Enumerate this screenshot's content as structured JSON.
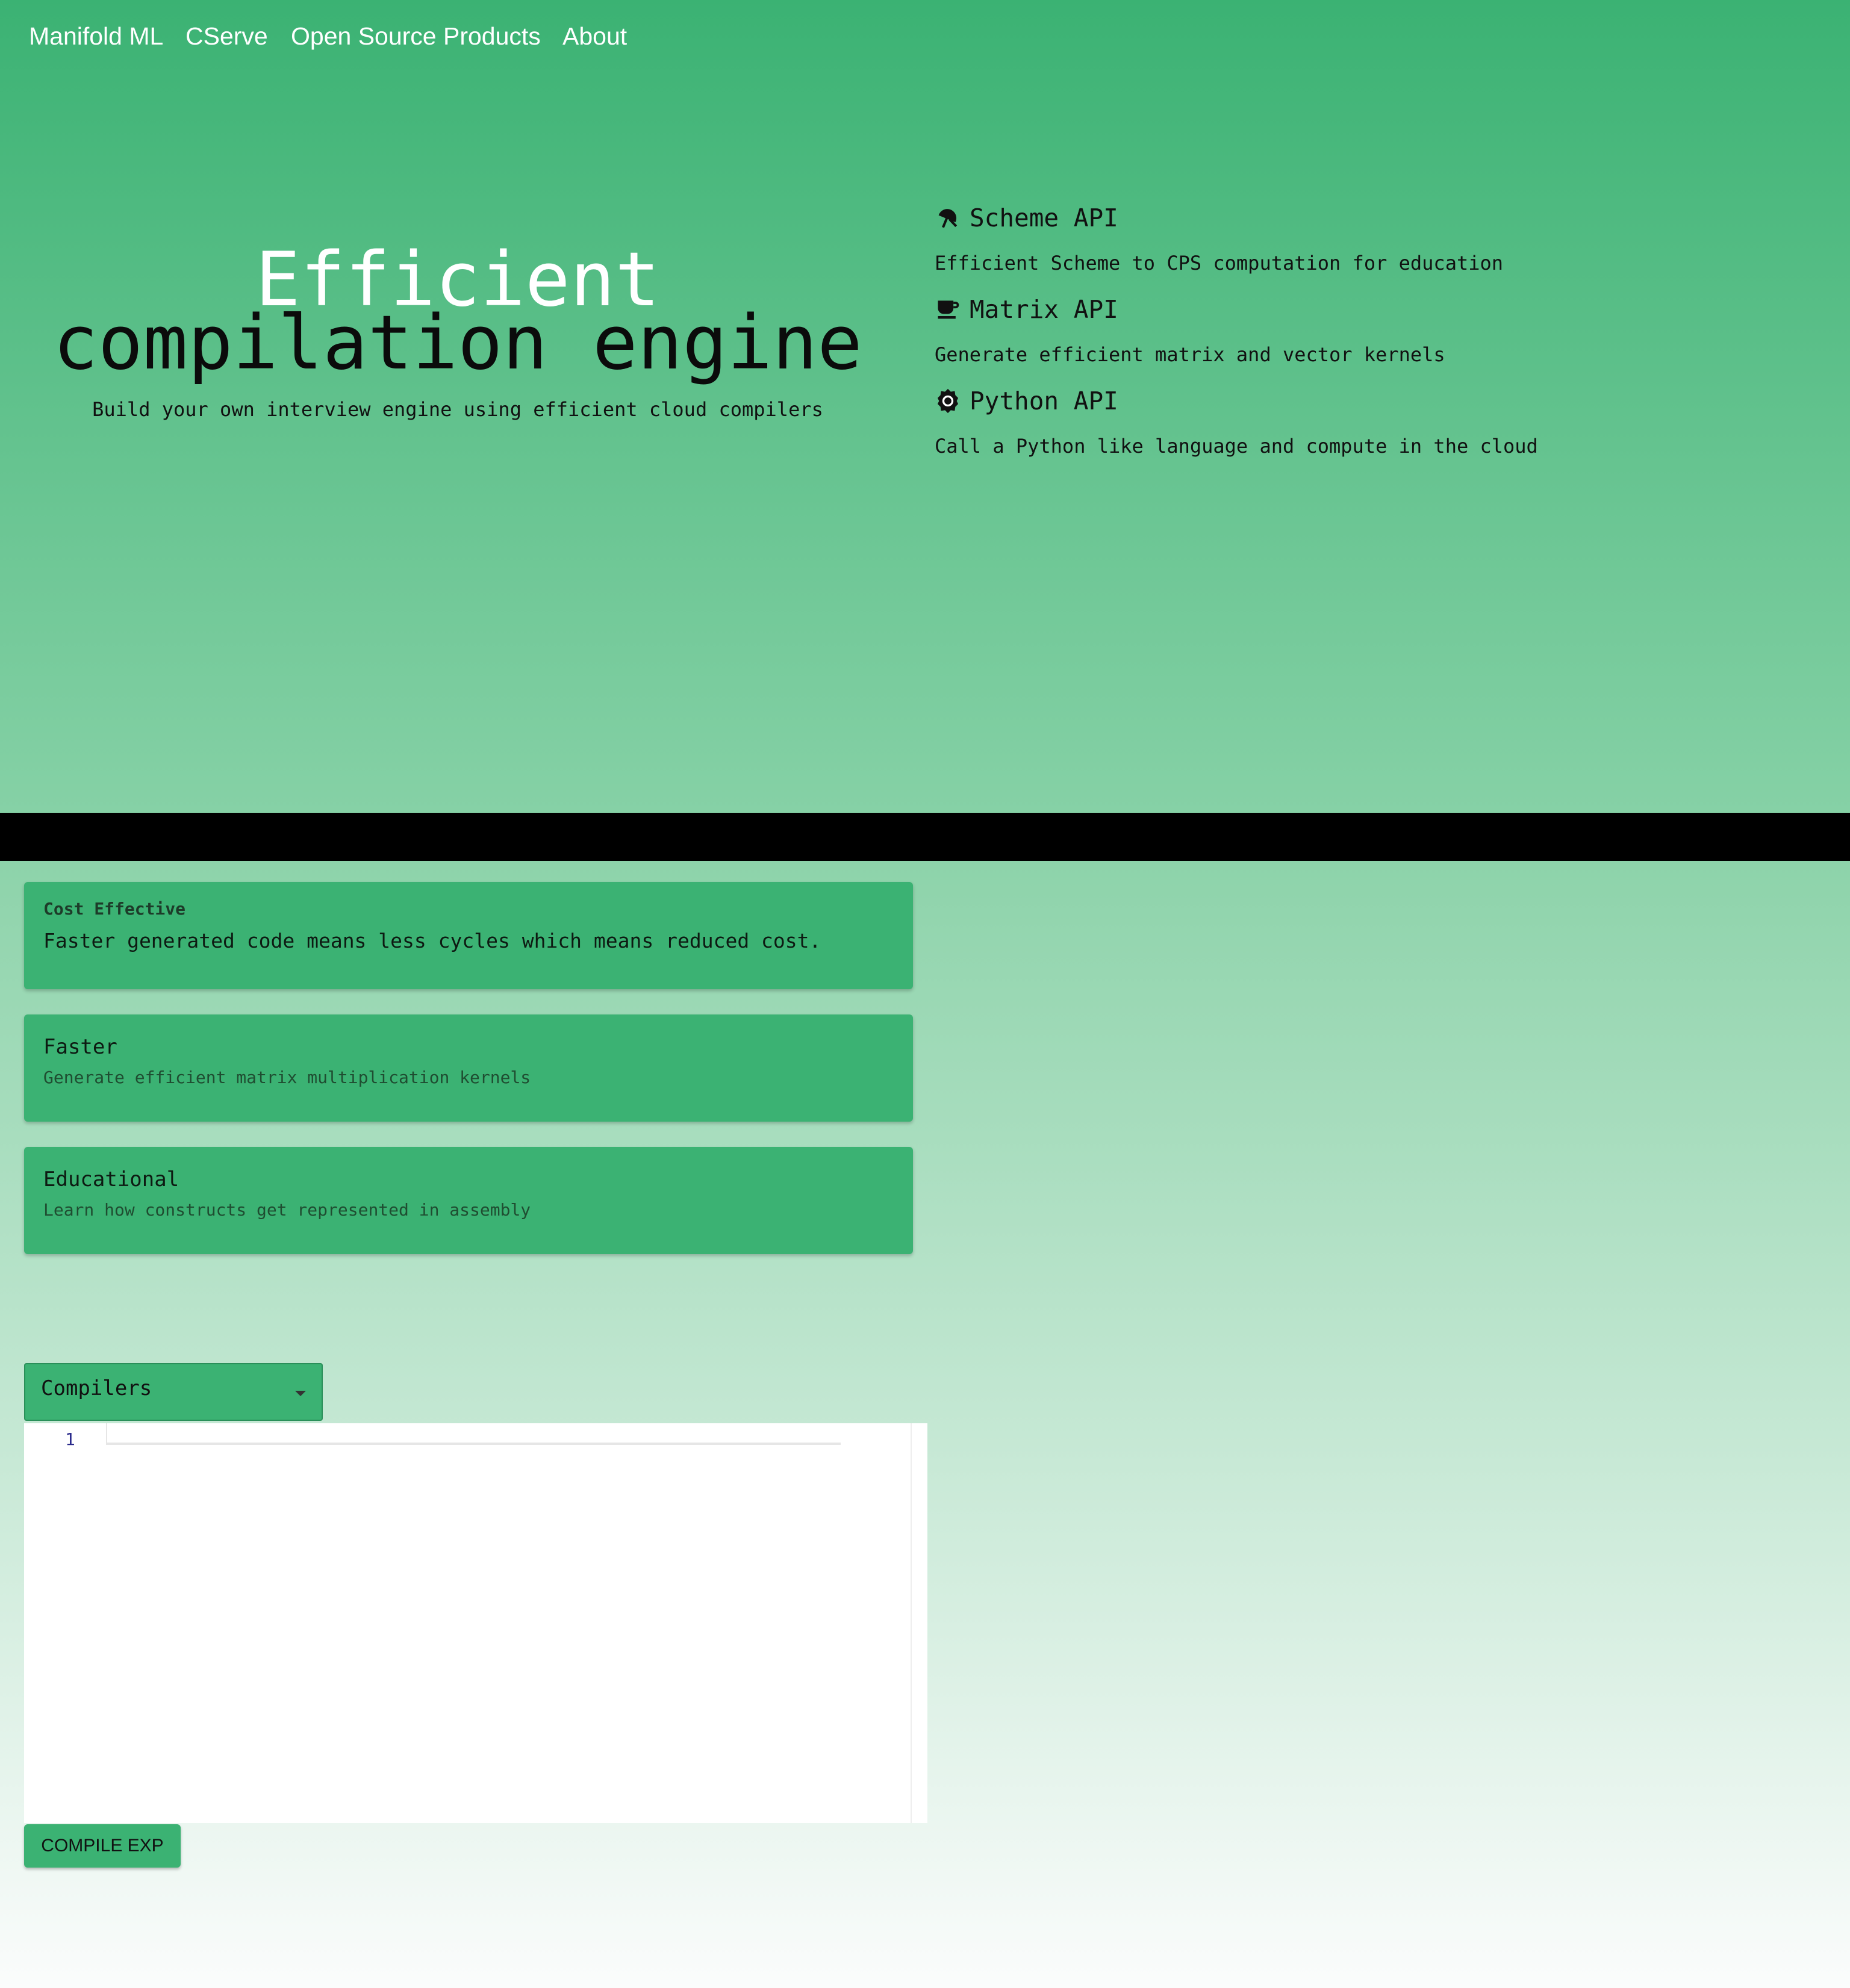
{
  "nav": {
    "links": [
      "Manifold ML",
      "CServe",
      "Open Source Products",
      "About"
    ]
  },
  "hero": {
    "title_line1": "Efficient",
    "title_line2": "compilation engine",
    "subtitle": "Build your own interview engine using efficient cloud compilers"
  },
  "features": [
    {
      "icon": "umbrella-icon",
      "title": "Scheme API",
      "description": "Efficient Scheme to CPS computation for education"
    },
    {
      "icon": "coffee-cup-icon",
      "title": "Matrix API",
      "description": "Generate efficient matrix and vector kernels"
    },
    {
      "icon": "settings-gear-icon",
      "title": "Python API",
      "description": "Call a Python like language and compute in the cloud"
    }
  ],
  "cards": [
    {
      "overline": "Cost Effective",
      "body": "Faster generated code means less cycles which means reduced cost."
    },
    {
      "title": "Faster",
      "subtitle": "Generate efficient matrix multiplication kernels"
    },
    {
      "title": "Educational",
      "subtitle": "Learn how constructs get represented in assembly"
    }
  ],
  "compiler_select": {
    "label": "Compilers"
  },
  "editor": {
    "line_number": "1"
  },
  "actions": {
    "compile_label": "COMPILE EXP"
  },
  "colors": {
    "brand_green": "#3bb273",
    "hero_title_white": "#ffffff",
    "divider": "#000000"
  }
}
